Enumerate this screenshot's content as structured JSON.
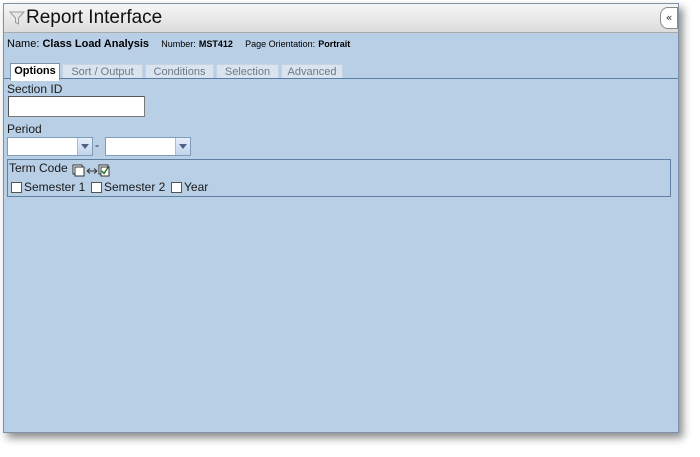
{
  "window": {
    "title": "Report Interface",
    "filter_icon": "filter-icon",
    "collapse_label": "«"
  },
  "info": {
    "name_label": "Name:",
    "name_value": "Class Load Analysis",
    "number_label": "Number:",
    "number_value": "MST412",
    "orientation_label": "Page Orientation:",
    "orientation_value": "Portrait"
  },
  "tabs": [
    {
      "label": "Options",
      "active": true
    },
    {
      "label": "Sort / Output",
      "active": false
    },
    {
      "label": "Conditions",
      "active": false
    },
    {
      "label": "Selection",
      "active": false
    },
    {
      "label": "Advanced",
      "active": false
    }
  ],
  "form": {
    "section_id": {
      "label": "Section ID",
      "value": ""
    },
    "period": {
      "label": "Period",
      "from": "",
      "to": "",
      "separator": "-"
    },
    "term_code": {
      "label": "Term Code",
      "toggle_icon": "toggle-all-checkboxes-icon",
      "options": [
        {
          "label": "Semester 1",
          "checked": false
        },
        {
          "label": "Semester 2",
          "checked": false
        },
        {
          "label": "Year",
          "checked": false
        }
      ]
    }
  }
}
